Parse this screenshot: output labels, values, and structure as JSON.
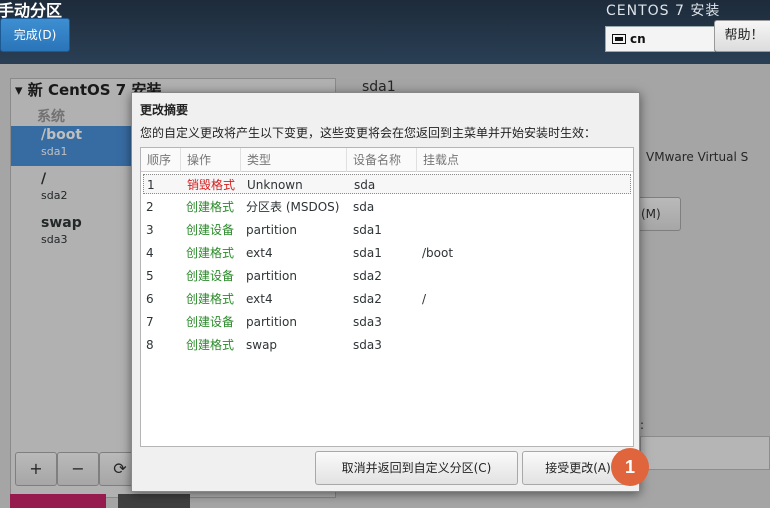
{
  "header": {
    "title": "手动分区",
    "done_label": "完成(D)",
    "product": "CENTOS 7 安装",
    "keyboard_layout": "cn",
    "help_label": "帮助！"
  },
  "left_panel": {
    "group_title": "▾ 新 CentOS 7 安装",
    "system_label": "系统",
    "mounts": [
      {
        "name": "/boot",
        "device": "sda1",
        "selected": true
      },
      {
        "name": "/",
        "device": "sda2",
        "selected": false
      },
      {
        "name": "swap",
        "device": "sda3",
        "selected": false
      }
    ],
    "tools": [
      "+",
      "−",
      "⟳"
    ]
  },
  "right_panel": {
    "title": "sda1",
    "device_text": "VMware Virtual S",
    "modify_button_fragment": "(M)",
    "field_colon": ":"
  },
  "dialog": {
    "title": "更改摘要",
    "description": "您的自定义更改将产生以下变更，这些变更将会在您返回到主菜单并开始安装时生效：",
    "columns": [
      "顺序",
      "操作",
      "类型",
      "设备名称",
      "挂载点"
    ],
    "rows": [
      {
        "order": "1",
        "action": "销毁格式",
        "kind": "destroy",
        "type": "Unknown",
        "device": "sda",
        "mount": "",
        "selected": true
      },
      {
        "order": "2",
        "action": "创建格式",
        "kind": "create",
        "type": "分区表 (MSDOS)",
        "device": "sda",
        "mount": ""
      },
      {
        "order": "3",
        "action": "创建设备",
        "kind": "create",
        "type": "partition",
        "device": "sda1",
        "mount": ""
      },
      {
        "order": "4",
        "action": "创建格式",
        "kind": "create",
        "type": "ext4",
        "device": "sda1",
        "mount": "/boot"
      },
      {
        "order": "5",
        "action": "创建设备",
        "kind": "create",
        "type": "partition",
        "device": "sda2",
        "mount": ""
      },
      {
        "order": "6",
        "action": "创建格式",
        "kind": "create",
        "type": "ext4",
        "device": "sda2",
        "mount": "/"
      },
      {
        "order": "7",
        "action": "创建设备",
        "kind": "create",
        "type": "partition",
        "device": "sda3",
        "mount": ""
      },
      {
        "order": "8",
        "action": "创建格式",
        "kind": "create",
        "type": "swap",
        "device": "sda3",
        "mount": ""
      }
    ],
    "cancel_label": "取消并返回到自定义分区(C)",
    "accept_label": "接受更改(A)"
  },
  "annotation_marker": "1",
  "colors": {
    "destroy": "#d42020",
    "create": "#2a8a2a",
    "accent": "#4a90d9",
    "marker": "#e0643c"
  }
}
